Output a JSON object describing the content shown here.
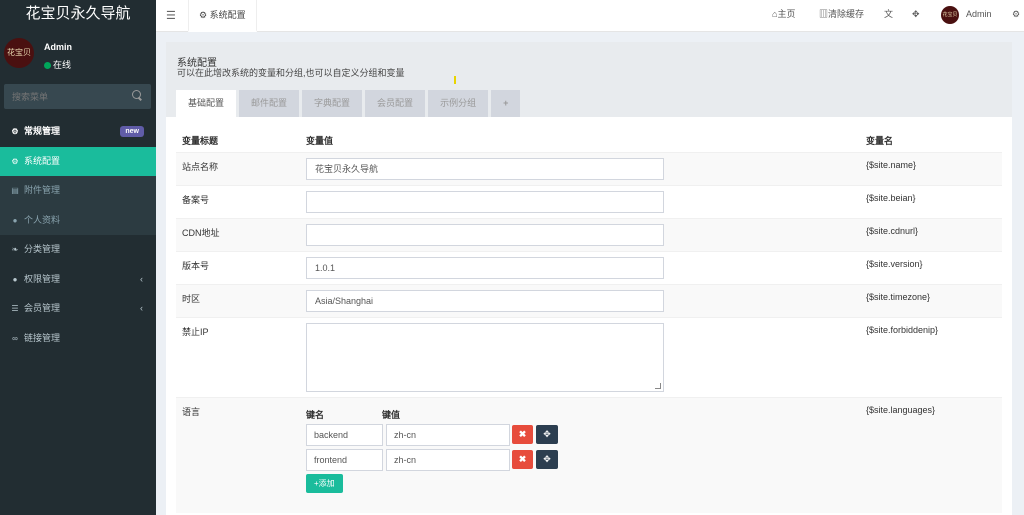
{
  "sidebar": {
    "logo": "花宝贝永久导航",
    "avatar_text": "花宝贝",
    "user_name": "Admin",
    "user_status": "在线",
    "search_placeholder": "搜索菜单",
    "menu": [
      {
        "label": "常规管理",
        "badge": "new"
      },
      {
        "label": "系统配置"
      },
      {
        "label": "附件管理"
      },
      {
        "label": "个人资料"
      },
      {
        "label": "分类管理"
      },
      {
        "label": "权限管理"
      },
      {
        "label": "会员管理"
      },
      {
        "label": "链接管理"
      }
    ]
  },
  "topbar": {
    "tab_label": "系统配置",
    "home": "主页",
    "clear_cache": "清除缓存",
    "user": "Admin"
  },
  "panel": {
    "title": "系统配置",
    "description": "可以在此增改系统的变量和分组,也可以自定义分组和变量",
    "tabs": [
      "基础配置",
      "邮件配置",
      "字典配置",
      "会员配置",
      "示例分组",
      "+"
    ]
  },
  "table": {
    "headers": {
      "title": "变量标题",
      "value": "变量值",
      "name": "变量名"
    },
    "rows": [
      {
        "title": "站点名称",
        "value": "花宝贝永久导航",
        "name": "{$site.name}"
      },
      {
        "title": "备案号",
        "value": "",
        "name": "{$site.beian}"
      },
      {
        "title": "CDN地址",
        "value": "",
        "name": "{$site.cdnurl}"
      },
      {
        "title": "版本号",
        "value": "1.0.1",
        "name": "{$site.version}"
      },
      {
        "title": "时区",
        "value": "Asia/Shanghai",
        "name": "{$site.timezone}"
      },
      {
        "title": "禁止IP",
        "value": "",
        "name": "{$site.forbiddenip}"
      }
    ],
    "languages": {
      "title": "语言",
      "name": "{$site.languages}",
      "key_header": "键名",
      "value_header": "键值",
      "entries": [
        {
          "key": "backend",
          "value": "zh-cn"
        },
        {
          "key": "frontend",
          "value": "zh-cn"
        }
      ],
      "add_label": "添加"
    }
  }
}
